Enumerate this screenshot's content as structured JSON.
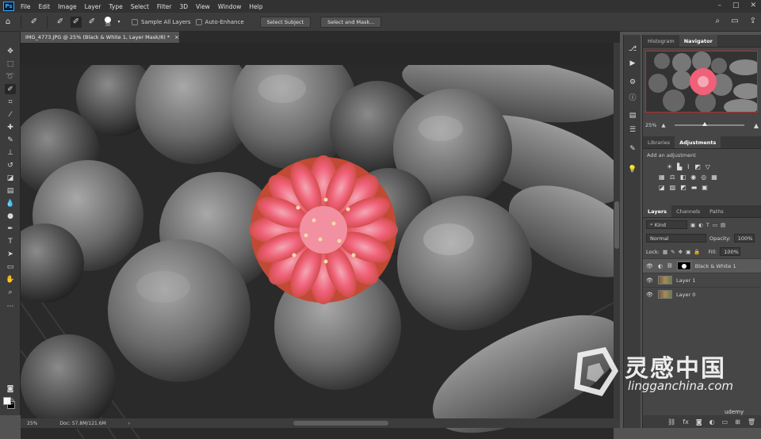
{
  "app": {
    "logo": "Ps"
  },
  "menu": [
    "File",
    "Edit",
    "Image",
    "Layer",
    "Type",
    "Select",
    "Filter",
    "3D",
    "View",
    "Window",
    "Help"
  ],
  "options": {
    "brush_size": "30",
    "sample_all_layers": "Sample All Layers",
    "auto_enhance": "Auto-Enhance",
    "select_subject": "Select Subject",
    "select_and_mask": "Select and Mask..."
  },
  "document": {
    "tab_title": "IMG_4773.JPG @ 25% (Black & White 1, Layer Mask/8) *",
    "close": "×"
  },
  "status": {
    "zoom": "25%",
    "doc_info": "Doc: 57.8M/121.6M"
  },
  "navigator": {
    "tabs": [
      "Histogram",
      "Navigator"
    ],
    "active": "Navigator",
    "zoom": "25%"
  },
  "adjustments": {
    "tabs": [
      "Libraries",
      "Adjustments"
    ],
    "active": "Adjustments",
    "title": "Add an adjustment"
  },
  "layers": {
    "tabs": [
      "Layers",
      "Channels",
      "Paths"
    ],
    "active": "Layers",
    "filter_kind": "Kind",
    "blend_mode": "Normal",
    "opacity_label": "Opacity:",
    "opacity_value": "100%",
    "lock_label": "Lock:",
    "fill_label": "Fill:",
    "fill_value": "100%",
    "items": [
      {
        "name": "Black & White 1"
      },
      {
        "name": "Layer 1"
      },
      {
        "name": "Layer 0"
      }
    ]
  },
  "watermark": {
    "title": "灵感中国",
    "url": "lingganchina.com",
    "brand": "udemy"
  },
  "colors": {
    "accent_red": "#bf2c2c",
    "ps_blue": "#31a8ff",
    "pink": "#f05a78"
  }
}
